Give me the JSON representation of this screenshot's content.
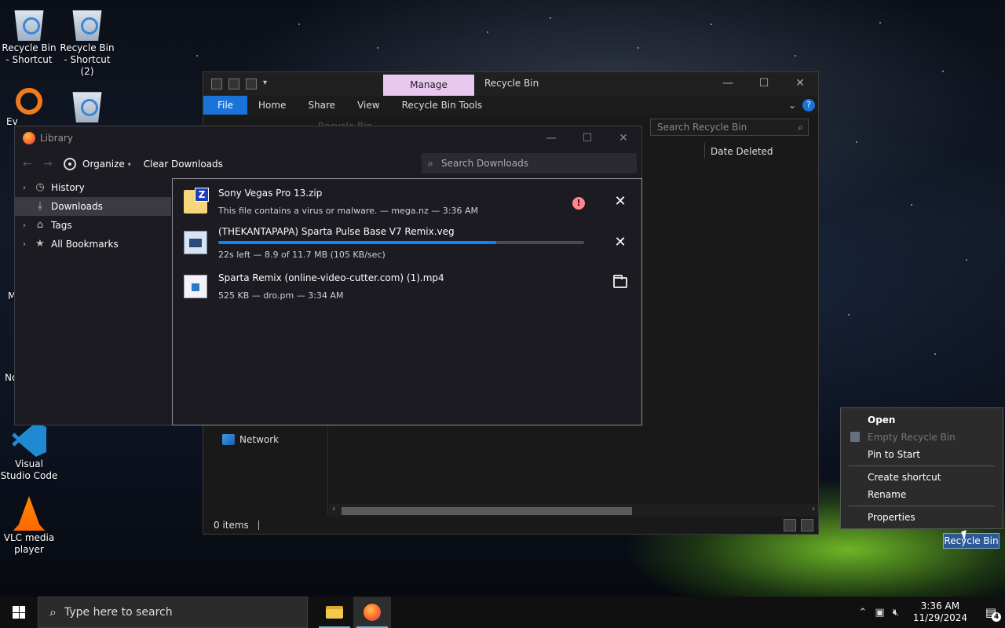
{
  "desktop": {
    "icons": [
      {
        "label": "Recycle Bin - Shortcut"
      },
      {
        "label": "Recycle Bin - Shortcut (2)"
      },
      {
        "label": "Visual Studio Code"
      },
      {
        "label": "VLC media player"
      }
    ],
    "partial_labels": [
      "Ev",
      "M",
      "No"
    ]
  },
  "explorer": {
    "title": "Recycle Bin",
    "manage_tab": "Manage",
    "ribbon_tabs": [
      "File",
      "Home",
      "Share",
      "View",
      "Recycle Bin Tools"
    ],
    "address": "Recycle Bin",
    "search_placeholder": "Search Recycle Bin",
    "column_date_deleted": "Date Deleted",
    "nav_network": "Network",
    "status_items": "0 items"
  },
  "library": {
    "title": "Library",
    "organize": "Organize",
    "clear_downloads": "Clear Downloads",
    "search_placeholder": "Search Downloads",
    "sidebar": [
      {
        "label": "History",
        "icon": "clock-icon"
      },
      {
        "label": "Downloads",
        "icon": "download-icon"
      },
      {
        "label": "Tags",
        "icon": "tag-icon"
      },
      {
        "label": "All Bookmarks",
        "icon": "star-icon"
      }
    ],
    "downloads": [
      {
        "name": "Sony Vegas Pro 13.zip",
        "status": "This file contains a virus or malware. — mega.nz — 3:36 AM"
      },
      {
        "name": "(THEKANTAPAPA) Sparta Pulse Base V7 Remix.veg",
        "status": "22s left — 8.9 of 11.7 MB (105 KB/sec)",
        "progress": 0.76
      },
      {
        "name": "Sparta Remix (online-video-cutter.com) (1).mp4",
        "status": "525 KB — dro.pm — 3:34 AM"
      }
    ]
  },
  "context_menu": {
    "items": [
      "Open",
      "Empty Recycle Bin",
      "Pin to Start",
      "Create shortcut",
      "Rename",
      "Properties"
    ],
    "target_label": "Recycle Bin"
  },
  "taskbar": {
    "search_placeholder": "Type here to search",
    "time": "3:36 AM",
    "date": "11/29/2024",
    "notification_count": "4"
  },
  "colors": {
    "accent": "#0a84ff",
    "file_tab": "#1a73d9",
    "manage_tab": "#e8c8ef",
    "warning": "#ff848b"
  }
}
